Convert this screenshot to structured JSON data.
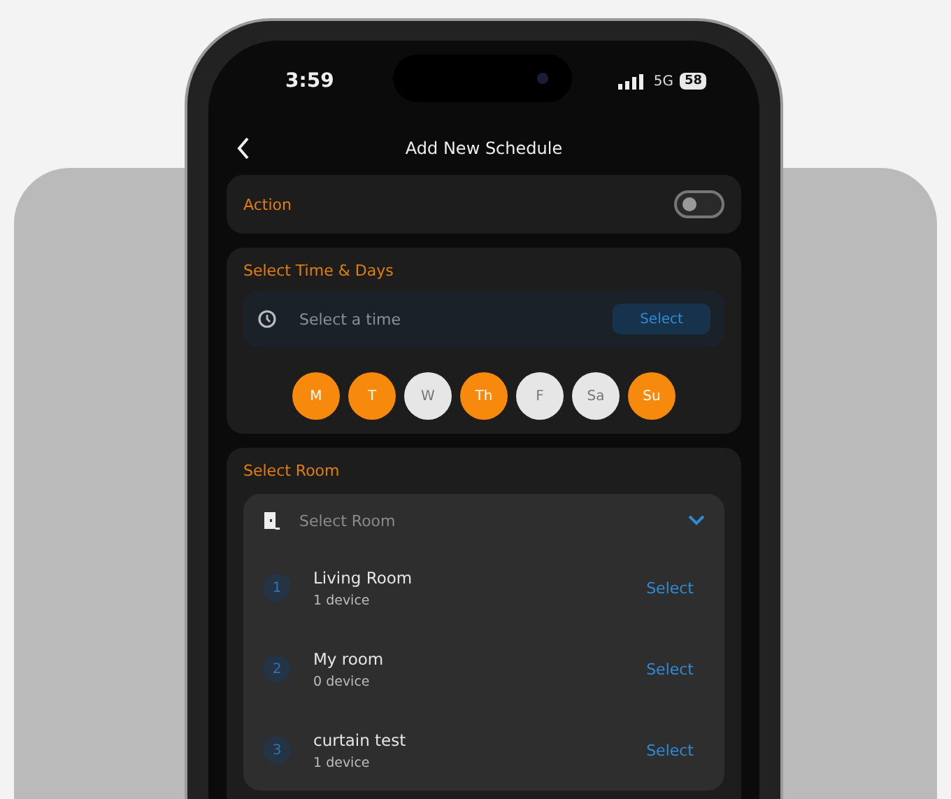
{
  "status_bar": {
    "time": "3:59",
    "network": "5G",
    "battery": "58"
  },
  "header": {
    "title": "Add New Schedule"
  },
  "action": {
    "label": "Action",
    "on": false
  },
  "time_days": {
    "title": "Select Time & Days",
    "time_field": {
      "placeholder": "Select a time"
    },
    "select_button": "Select",
    "days": [
      {
        "label": "M",
        "selected": true
      },
      {
        "label": "T",
        "selected": true
      },
      {
        "label": "W",
        "selected": false
      },
      {
        "label": "Th",
        "selected": true
      },
      {
        "label": "F",
        "selected": false
      },
      {
        "label": "Sa",
        "selected": false
      },
      {
        "label": "Su",
        "selected": true
      }
    ]
  },
  "room": {
    "title": "Select Room",
    "dropdown": {
      "placeholder": "Select Room",
      "expanded": true
    },
    "rooms": [
      {
        "number": "1",
        "name": "Living Room",
        "devices": "1 device",
        "action": "Select"
      },
      {
        "number": "2",
        "name": "My room",
        "devices": "0 device",
        "action": "Select"
      },
      {
        "number": "3",
        "name": "curtain test",
        "devices": "1 device",
        "action": "Select"
      }
    ]
  }
}
